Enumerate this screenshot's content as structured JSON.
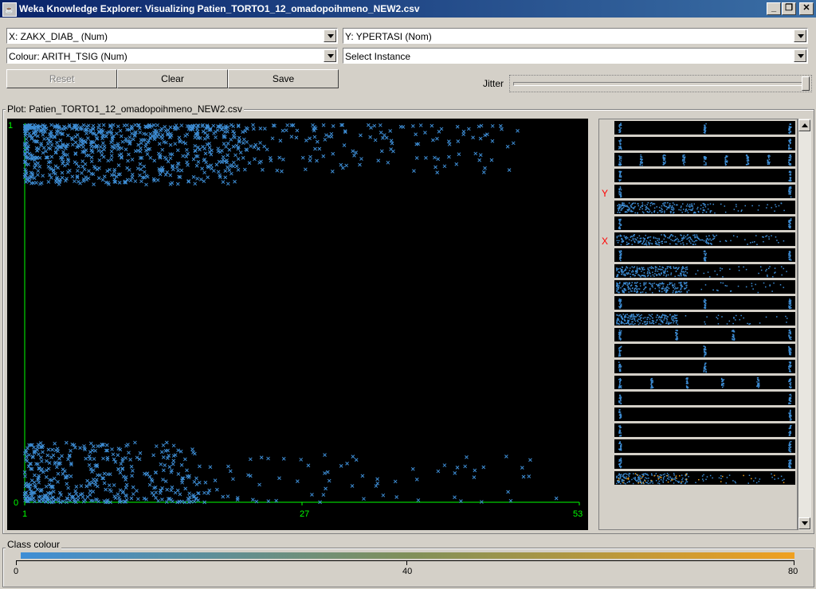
{
  "window": {
    "title": "Weka Knowledge Explorer: Visualizing Patien_TORTO1_12_omadopoihmeno_NEW2.csv",
    "icon": "weka-icon",
    "controls": [
      "minimize-icon",
      "maximize-icon",
      "close-icon"
    ]
  },
  "selectors": {
    "x_axis": "X: ZAKX_DIAB_ (Num)",
    "y_axis": "Y: YPERTASI (Nom)",
    "colour": "Colour: ARITH_TSIG (Num)",
    "instance": "Select Instance"
  },
  "buttons": {
    "reset": "Reset",
    "clear": "Clear",
    "save": "Save"
  },
  "jitter": {
    "label": "Jitter",
    "value_fraction": 1.0
  },
  "plot": {
    "label": "Plot: Patien_TORTO1_12_omadopoihmeno_NEW2.csv",
    "x_ticks": [
      "1",
      "27",
      "53"
    ],
    "y_ticks": [
      "1",
      "0"
    ],
    "point_color": "#3e8ed6",
    "axis_color": "#00ff00"
  },
  "chart_data": {
    "type": "scatter",
    "xlim": [
      1,
      53
    ],
    "ylim": [
      0,
      1
    ],
    "y_categories": [
      "0",
      "1"
    ],
    "marker": "x",
    "approx_clusters": [
      {
        "y": 1,
        "x_dense_range": [
          1,
          21
        ],
        "x_sparse_range": [
          21,
          48
        ],
        "approx_points": 900
      },
      {
        "y": 0,
        "x_dense_range": [
          1,
          17
        ],
        "x_sparse_range": [
          17,
          51
        ],
        "approx_points": 500
      }
    ]
  },
  "attribute_panel": {
    "y_marker": "Y",
    "x_marker": "X",
    "y_row": 4,
    "x_row": 7,
    "row_count": 23
  },
  "class_colour": {
    "label": "Class colour",
    "min": "0",
    "mid": "40",
    "max": "80",
    "color_low": "#3e8ed6",
    "color_high": "#f0a020"
  }
}
